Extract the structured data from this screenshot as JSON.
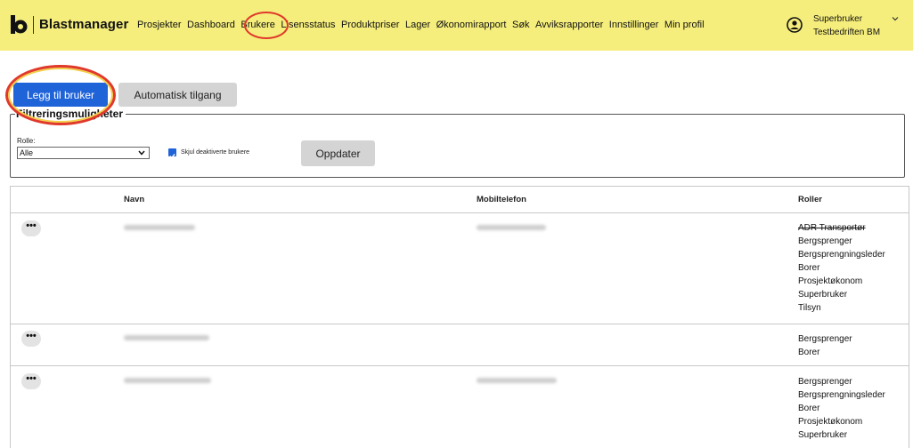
{
  "header": {
    "brand": "Blastmanager",
    "nav": [
      "Prosjekter",
      "Dashboard",
      "Brukere",
      "Lisensstatus",
      "Produktpriser",
      "Lager",
      "Økonomirapport",
      "Søk",
      "Avviksrapporter",
      "Innstillinger",
      "Min profil"
    ],
    "active_nav": "Brukere",
    "user": {
      "name": "Superbruker",
      "company": "Testbedriften BM"
    }
  },
  "actions": {
    "add_user": "Legg til bruker",
    "auto_access": "Automatisk tilgang"
  },
  "filter": {
    "legend": "Filtreringsmuligheter",
    "role_label": "Rolle:",
    "role_selected": "Alle",
    "hide_deactivated_label": "Skjul deaktiverte brukere",
    "hide_deactivated_checked": true,
    "update_button": "Oppdater"
  },
  "table": {
    "headers": {
      "name": "Navn",
      "mobile": "Mobiltelefon",
      "roles": "Roller"
    },
    "more_label": "•••",
    "rows": [
      {
        "roles": [
          "ADR Transportør",
          "Bergsprenger",
          "Bergsprengningsleder",
          "Borer",
          "Prosjektøkonom",
          "Superbruker",
          "Tilsyn"
        ]
      },
      {
        "roles": [
          "Bergsprenger",
          "Borer"
        ]
      },
      {
        "roles": [
          "Bergsprenger",
          "Bergsprengningsleder",
          "Borer",
          "Prosjektøkonom",
          "Superbruker"
        ]
      }
    ]
  },
  "colors": {
    "header_bg": "#f5ee7c",
    "primary": "#1f63d8",
    "highlight_ring": "#e0392b"
  }
}
